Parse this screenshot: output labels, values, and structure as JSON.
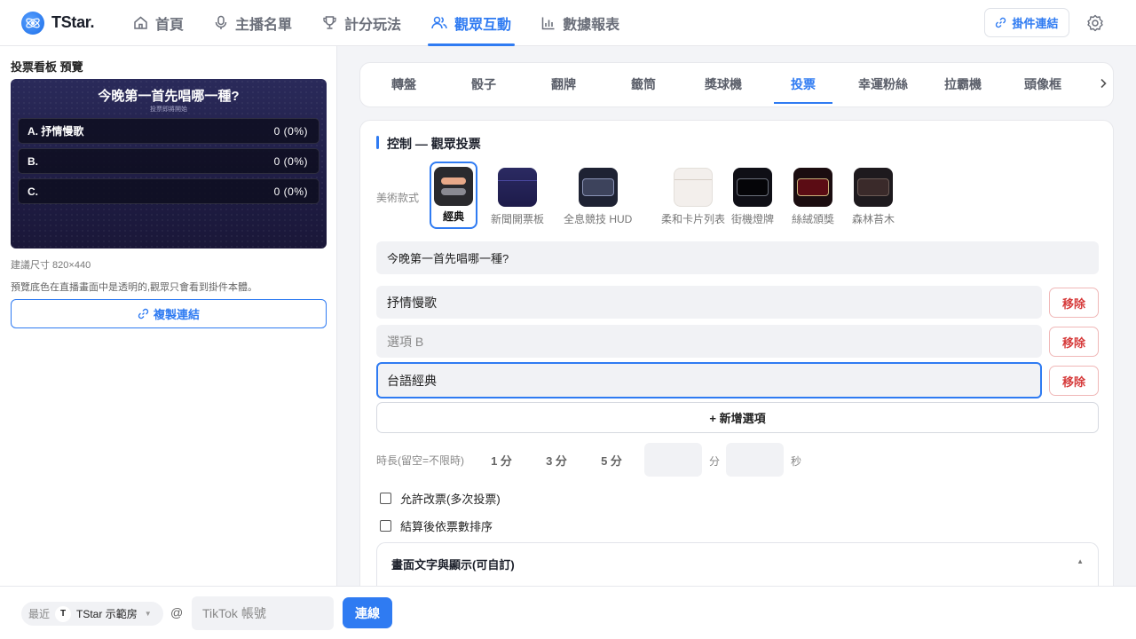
{
  "brand": {
    "name": "TStar."
  },
  "nav": {
    "items": [
      {
        "label": "首頁",
        "icon": "home-icon"
      },
      {
        "label": "主播名單",
        "icon": "microphone-icon"
      },
      {
        "label": "計分玩法",
        "icon": "trophy-icon"
      },
      {
        "label": "觀眾互動",
        "icon": "users-icon",
        "active": true
      },
      {
        "label": "數據報表",
        "icon": "bar-chart-icon"
      }
    ],
    "plugin_link_label": "掛件連結"
  },
  "left": {
    "title": "投票看板 預覽",
    "preview": {
      "question": "今晚第一首先唱哪一種?",
      "subtitle": "投票即將開始",
      "rows": [
        {
          "label": "A. 抒情慢歌",
          "count": "0 (0%)"
        },
        {
          "label": "B.",
          "count": "0 (0%)"
        },
        {
          "label": "C.",
          "count": "0 (0%)"
        }
      ]
    },
    "size_note": "建議尺寸 820×440",
    "bg_note": "預覽底色在直播畫面中是透明的,觀眾只會看到掛件本體。",
    "copy_link_label": "複製連結"
  },
  "game_tabs": [
    "轉盤",
    "骰子",
    "翻牌",
    "籤筒",
    "獎球機",
    "投票",
    "幸運粉絲",
    "拉霸機",
    "頭像框"
  ],
  "game_tabs_active": "投票",
  "control": {
    "title": "控制 — 觀眾投票",
    "style_label": "美術款式",
    "styles": [
      "經典",
      "新聞開票板",
      "全息競技 HUD",
      "柔和卡片列表",
      "街機燈牌",
      "絲絨頒獎",
      "森林苔木"
    ],
    "style_selected": "經典",
    "question_value": "今晚第一首先唱哪一種?",
    "options": [
      {
        "value": "抒情慢歌",
        "placeholder": ""
      },
      {
        "value": "",
        "placeholder": "選項 B"
      },
      {
        "value": "台語經典",
        "placeholder": ""
      }
    ],
    "remove_label": "移除",
    "add_option_label": "+ 新增選項",
    "duration_label": "時長(留空=不限時)",
    "duration_presets": [
      "1 分",
      "3 分",
      "5 分"
    ],
    "minutes_unit": "分",
    "seconds_unit": "秒",
    "allow_change_label": "允許改票(多次投票)",
    "sort_after_label": "結算後依票數排序",
    "display_section_title": "畫面文字與顯示(可自訂)"
  },
  "bottom": {
    "recent_label": "最近",
    "recent_avatar": "T",
    "recent_room": "TStar 示範房",
    "at_symbol": "@",
    "tiktok_placeholder": "TikTok 帳號",
    "connect_label": "連線"
  },
  "colors": {
    "accent": "#2f7bf2",
    "danger": "#d63b3b"
  }
}
